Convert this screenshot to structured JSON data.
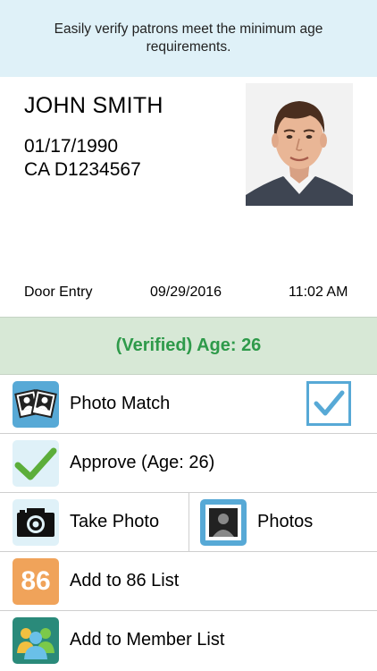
{
  "banner": {
    "text": "Easily verify patrons meet the minimum age requirements."
  },
  "id_card": {
    "name": "JOHN SMITH",
    "dob": "01/17/1990",
    "license": "CA D1234567",
    "photo_icon": "patron-portrait"
  },
  "scan": {
    "location": "Door Entry",
    "date": "09/29/2016",
    "time": "11:02 AM"
  },
  "status": {
    "text": "(Verified) Age: 26",
    "color": "#2e9a4a"
  },
  "actions": {
    "photo_match": {
      "label": "Photo Match",
      "icon": "photo-match-icon",
      "checked": true
    },
    "approve": {
      "label": "Approve (Age: 26)",
      "icon": "checkmark-icon"
    },
    "take_photo": {
      "label": "Take Photo",
      "icon": "camera-icon"
    },
    "photos": {
      "label": "Photos",
      "icon": "photos-icon"
    },
    "add_86": {
      "label": "Add to 86 List",
      "badge": "86",
      "icon": "86-badge-icon"
    },
    "add_member": {
      "label": "Add to Member List",
      "icon": "members-icon"
    }
  },
  "colors": {
    "banner_bg": "#dff1f8",
    "status_bg": "#d7e8d6",
    "accent_blue": "#57a9d6",
    "orange": "#f0a35a",
    "teal": "#2a8a7a"
  }
}
